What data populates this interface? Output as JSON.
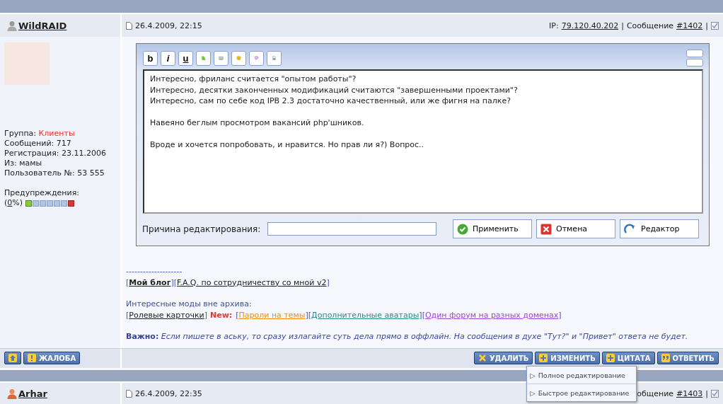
{
  "post": {
    "author": "WildRAID",
    "date": "26.4.2009, 22:15",
    "ip_label": "IP:",
    "ip": "79.120.40.202",
    "separator": "|",
    "message_label": "Сообщение",
    "message_number": "#1402",
    "checked": true,
    "profile": {
      "group_label": "Группа:",
      "group": "Клиенты",
      "lines": [
        "Сообщений: 717",
        "Регистрация: 23.11.2006",
        "Из: мамы",
        "Пользователь №: 53 555"
      ],
      "warnings_label": "Предупреждения:",
      "warnings_prefix": "(",
      "warnings_value": "0",
      "warnings_suffix": "%)"
    },
    "editor": {
      "toolbar": [
        {
          "kind": "text",
          "label": "b"
        },
        {
          "kind": "text",
          "label": "i"
        },
        {
          "kind": "text",
          "label": "u"
        },
        {
          "kind": "link"
        },
        {
          "kind": "image"
        },
        {
          "kind": "smile"
        },
        {
          "kind": "quote"
        },
        {
          "kind": "code"
        }
      ],
      "paragraphs": [
        "Интересно, фриланс считается \"опытом работы\"?\nИнтересно, десятки законченных модификаций считаются \"завершенными проектами\"?\nИнтересно, сам по себе код IPB 2.3 достаточно качественный, или же фигня на палке?",
        "Навеяно беглым просмотром вакансий php'шников.",
        "Вроде и хочется попробовать, и нравится. Но прав ли я?) Вопрос.."
      ],
      "reason_label": "Причина редактирования:",
      "buttons": [
        {
          "kind": "apply",
          "label": "Применить"
        },
        {
          "kind": "cancel",
          "label": "Отмена"
        },
        {
          "kind": "full",
          "label": "Редактор"
        }
      ]
    },
    "signature": {
      "divider": "--------------------",
      "lines": [
        {
          "segments": [
            {
              "kind": "bracket",
              "text": "["
            },
            {
              "kind": "link",
              "text": "Мой блог",
              "bold": true,
              "color": "#222222"
            },
            {
              "kind": "bracket",
              "text": "]["
            },
            {
              "kind": "link",
              "text": "F.A.Q. по сотрудничеству со мной v2",
              "bold": false,
              "color": "#222222"
            },
            {
              "kind": "bracket",
              "text": "]"
            }
          ]
        },
        {
          "segments": [
            {
              "kind": "plain",
              "text": "Интересные моды вне архива:"
            }
          ]
        },
        {
          "segments": [
            {
              "kind": "bracket",
              "text": "["
            },
            {
              "kind": "link",
              "text": "Ролевые карточки",
              "bold": false,
              "color": "#222222"
            },
            {
              "kind": "bracket",
              "text": "]"
            },
            {
              "kind": "new",
              "text": "New:"
            },
            {
              "kind": "bracket",
              "text": "["
            },
            {
              "kind": "link",
              "text": "Пароли на темы",
              "bold": false,
              "color": "#e8900c"
            },
            {
              "kind": "bracket",
              "text": "]["
            },
            {
              "kind": "link",
              "text": "Дополнительные аватары",
              "bold": false,
              "color": "#2a8a8a"
            },
            {
              "kind": "bracket",
              "text": "]["
            },
            {
              "kind": "link",
              "text": "Один форум на разных доменах",
              "bold": false,
              "color": "#9a44d6"
            },
            {
              "kind": "bracket",
              "text": "]"
            }
          ]
        }
      ],
      "important": "**Важно:** *Если пишете в аську, то сразу излагайте суть дела прямо в оффлайн. На сообщения в духе \"Тут?\" и \"Привет\" ответа не будет.*"
    },
    "left_buttons": [
      {
        "kind": "up"
      },
      {
        "kind": "report",
        "label": "ЖАЛОБА"
      }
    ],
    "right_buttons": [
      {
        "kind": "delete",
        "label": "УДАЛИТЬ"
      },
      {
        "kind": "edit",
        "label": "ИЗМЕНИТЬ"
      },
      {
        "kind": "quote",
        "label": "ЦИТАТА"
      },
      {
        "kind": "reply",
        "label": "ОТВЕТИТЬ"
      }
    ],
    "edit_menu": [
      {
        "marker": "▷",
        "label": "Полное редактирование"
      },
      {
        "marker": "▷",
        "label": "Быстрое редактирование"
      }
    ]
  },
  "next_post": {
    "author": "Arhar",
    "date": "26.4.2009, 22:35",
    "message_label": "общение",
    "message_number": "#1403",
    "separator": "|",
    "checked": true
  }
}
